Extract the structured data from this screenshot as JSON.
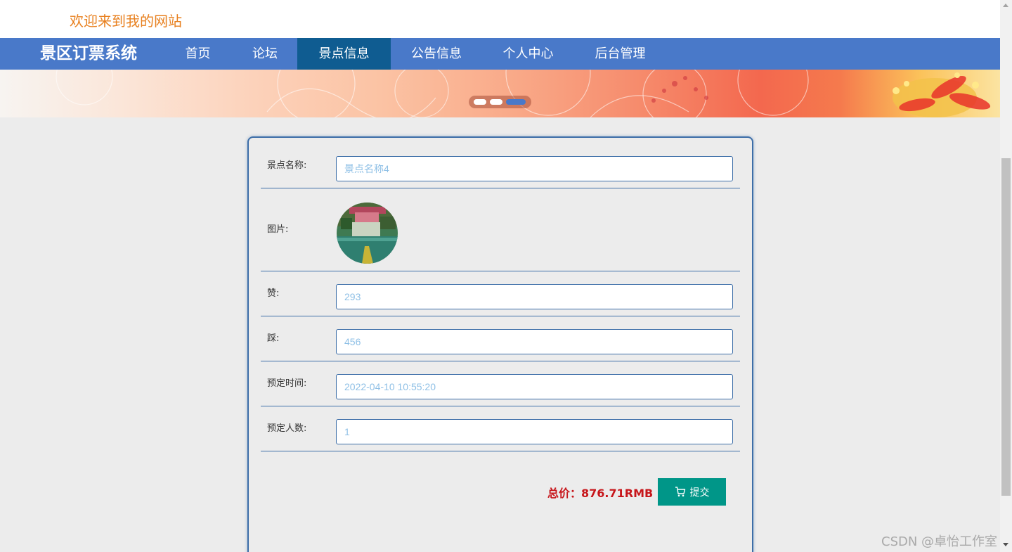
{
  "header": {
    "welcome": "欢迎来到我的网站"
  },
  "nav": {
    "brand": "景区订票系统",
    "items": [
      {
        "label": "首页"
      },
      {
        "label": "论坛"
      },
      {
        "label": "景点信息"
      },
      {
        "label": "公告信息"
      },
      {
        "label": "个人中心"
      },
      {
        "label": "后台管理"
      }
    ],
    "active_item": "景点信息"
  },
  "carousel": {
    "slide_count": 3,
    "active_index": 2
  },
  "form": {
    "name": {
      "label": "景点名称:",
      "value": "景点名称4"
    },
    "image": {
      "label": "图片:"
    },
    "likes": {
      "label": "赞:",
      "value": "293"
    },
    "dislikes": {
      "label": "踩:",
      "value": "456"
    },
    "time": {
      "label": "预定时间:",
      "value": "2022-04-10 10:55:20"
    },
    "people": {
      "label": "预定人数:",
      "value": "1"
    },
    "total": "总价：876.71RMB",
    "submit_label": "提交",
    "submit_icon": "cart-icon"
  },
  "watermark": "CSDN @卓怡工作室",
  "colors": {
    "nav_bg": "#4979c9",
    "nav_active": "#0f5c91",
    "welcome": "#e8801f",
    "total": "#c7161b",
    "submit_bg": "#009688",
    "field_border": "#3d6ea8",
    "field_text": "#8fc0e6"
  }
}
